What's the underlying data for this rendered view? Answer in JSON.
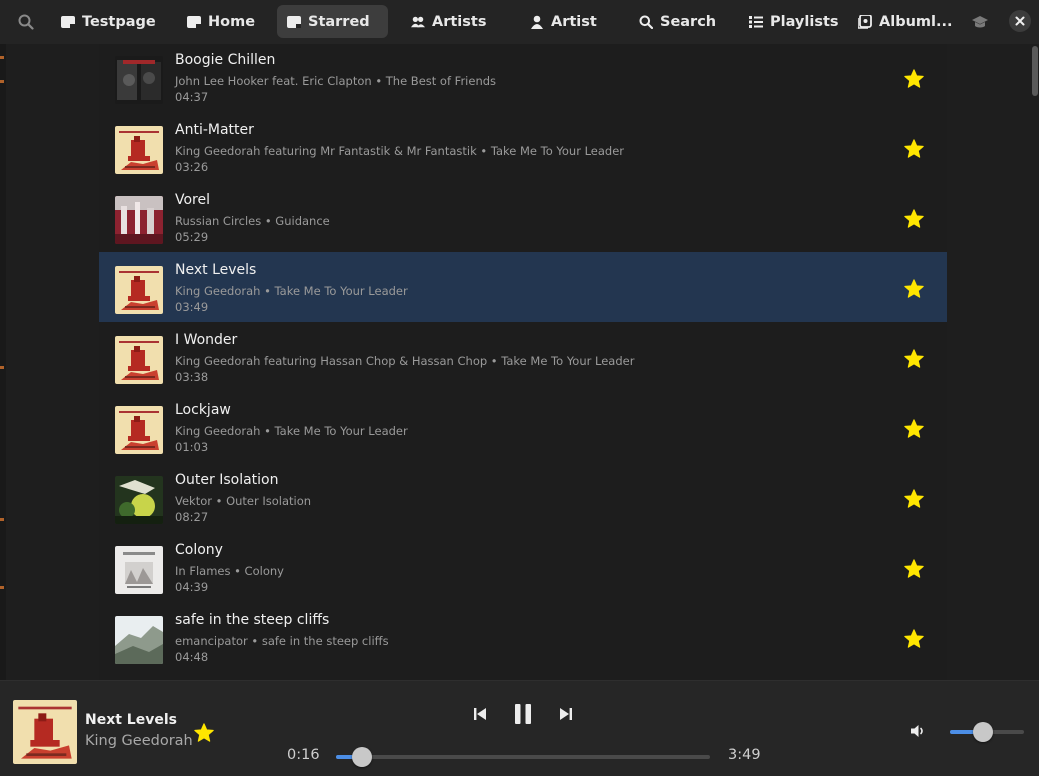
{
  "header": {
    "tabs": [
      {
        "label": "Testpage",
        "icon": "tag-icon"
      },
      {
        "label": "Home",
        "icon": "tag-icon"
      },
      {
        "label": "Starred",
        "icon": "tag-icon",
        "active": true
      },
      {
        "label": "Artists",
        "icon": "people-icon"
      },
      {
        "label": "Artist",
        "icon": "person-icon"
      },
      {
        "label": "Search",
        "icon": "search-icon"
      },
      {
        "label": "Playlists",
        "icon": "list-icon"
      },
      {
        "label": "Albuml...",
        "icon": "album-icon"
      }
    ]
  },
  "tracks": [
    {
      "title": "Boogie Chillen",
      "subtitle": "John Lee Hooker feat. Eric Clapton • The Best of Friends",
      "duration": "04:37",
      "cover": "dark",
      "starred": true
    },
    {
      "title": "Anti-Matter",
      "subtitle": "King Geedorah featuring Mr Fantastik & Mr Fantastik • Take Me To Your Leader",
      "duration": "03:26",
      "cover": "geedorah",
      "starred": true
    },
    {
      "title": "Vorel",
      "subtitle": "Russian Circles • Guidance",
      "duration": "05:29",
      "cover": "red",
      "starred": true
    },
    {
      "title": "Next Levels",
      "subtitle": "King Geedorah • Take Me To Your Leader",
      "duration": "03:49",
      "cover": "geedorah",
      "starred": true,
      "selected": true
    },
    {
      "title": "I Wonder",
      "subtitle": "King Geedorah featuring Hassan Chop & Hassan Chop • Take Me To Your Leader",
      "duration": "03:38",
      "cover": "geedorah",
      "starred": true
    },
    {
      "title": "Lockjaw",
      "subtitle": "King Geedorah • Take Me To Your Leader",
      "duration": "01:03",
      "cover": "geedorah",
      "starred": true
    },
    {
      "title": "Outer Isolation",
      "subtitle": "Vektor • Outer Isolation",
      "duration": "08:27",
      "cover": "green",
      "starred": true
    },
    {
      "title": "Colony",
      "subtitle": "In Flames • Colony",
      "duration": "04:39",
      "cover": "white",
      "starred": true
    },
    {
      "title": "safe in the steep cliffs",
      "subtitle": "emancipator • safe in the steep cliffs",
      "duration": "04:48",
      "cover": "cliff",
      "starred": true
    }
  ],
  "player": {
    "title": "Next Levels",
    "artist": "King Geedorah",
    "starred": true,
    "elapsed": "0:16",
    "total": "3:49",
    "progress": 0.07,
    "volume": 0.45
  },
  "colors": {
    "accent": "#4c8ee6",
    "star": "#ffe600",
    "selected_row": "#233650"
  }
}
